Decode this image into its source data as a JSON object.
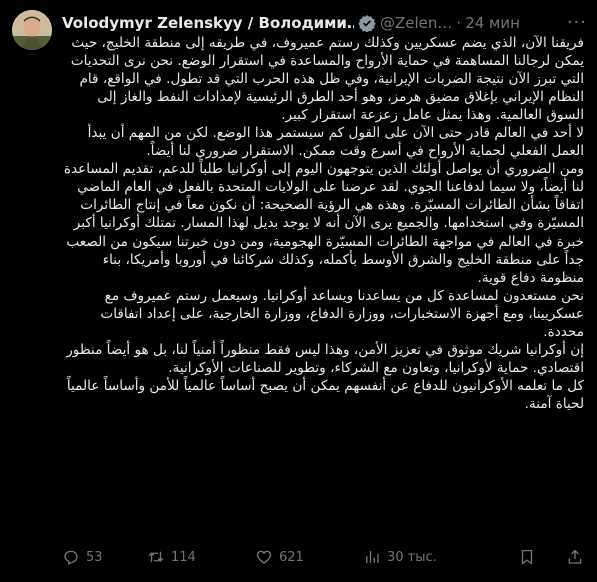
{
  "tweet": {
    "author_name": "Volodymyr Zelenskyy / Володими…",
    "handle": "@Zelen…",
    "separator": "·",
    "time": "24 мин",
    "paragraphs": [
      "فريقنا الآن، الذي يضم عسكريين وكذلك رستم عميروف، في طريقه إلى منطقة الخليج، حيث يمكن لرجالنا المساهمة في حماية الأرواح والمساعدة في استقرار الوضع. نحن نرى التحديات التي تبرز الآن نتيجة الضربات الإيرانية، وفي ظل هذه الحرب التي قد تطول. في الواقع، قام النظام الإيراني بإغلاق مضيق هرمز، وهو أحد الطرق الرئيسية لإمدادات النفط والغاز إلى السوق العالمية. وهذا يمثل عامل زعزعة استقرار كبير.",
      "لا أحد في العالم قادر حتى الآن على القول كم سيستمر هذا الوضع. لكن من المهم أن يبدأ العمل الفعلي لحماية الأرواح في أسرع وقت ممكن. الاستقرار ضروري لنا أيضاً.",
      "ومن الضروري أن يواصل أولئك الذين يتوجهون اليوم إلى أوكرانيا طلباً للدعم، تقديم المساعدة لنا أيضاً، ولا سيما لدفاعنا الجوي. لقد عرضنا على الولايات المتحدة بالفعل في العام الماضي اتفاقاً بشأن الطائرات المسيّرة. وهذه هي الرؤية الصحيحة: أن نكون معاً في إنتاج الطائرات المسيّرة وفي استخدامها. والجميع يرى الآن أنه لا يوجد بديل لهذا المسار. تمتلك أوكرانيا أكبر خبرة في العالم في مواجهة الطائرات المسيّرة الهجومية، ومن دون خبرتنا سيكون من الصعب جداً على منطقة الخليج والشرق الأوسط بأكمله، وكذلك شركائنا في أوروبا وأمريكا، بناء منظومة دفاع قوية.",
      "نحن مستعدون لمساعدة كل من يساعدنا ويساعد أوكرانيا. وسيعمل رستم عميروف مع عسكريينا، ومع أجهزة الاستخبارات، ووزارة الدفاع، ووزارة الخارجية، على إعداد اتفاقات محددة.",
      "إن أوكرانيا شريك موثوق في تعزيز الأمن، وهذا ليس فقط منظوراً أمنياً لنا، بل هو أيضاً منظور اقتصادي. حماية لأوكرانيا، وتعاون مع الشركاء، وتطوير للصناعات الأوكرانية.",
      "كل ما تعلمه الأوكرانيون للدفاع عن أنفسهم يمكن أن يصبح أساساً عالمياً للأمن وأساساً عالمياً لحياة آمنة."
    ],
    "stats": {
      "replies": "53",
      "reposts": "114",
      "likes": "621",
      "views": "30 тыс."
    },
    "colors": {
      "background": "#000000",
      "text": "#e7e9ea",
      "muted": "#71767b",
      "verified": "#8b98a5"
    }
  }
}
